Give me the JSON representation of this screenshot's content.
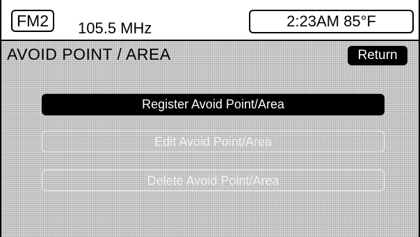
{
  "status": {
    "band": "FM2",
    "frequency": "105.5 MHz",
    "clock": "2:23AM 85°F"
  },
  "page": {
    "title": "AVOID POINT / AREA",
    "return_label": "Return"
  },
  "menu": {
    "register_label": "Register Avoid Point/Area",
    "edit_label": "Edit Avoid Point/Area",
    "delete_label": "Delete Avoid Point/Area"
  }
}
